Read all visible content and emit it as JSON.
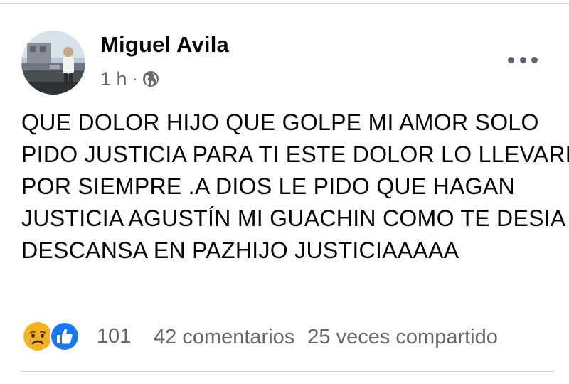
{
  "post": {
    "author": "Miguel Avila",
    "time": "1 h",
    "separator": "·",
    "privacy_icon": "globe-icon",
    "more_icon": "more-horizontal-icon",
    "text_lines": [
      "QUE DOLOR HIJO QUE GOLPE MI AMOR SOLO",
      "PIDO JUSTICIA PARA TI ESTE DOLOR LO LLEVARÉ",
      "POR SIEMPRE .A DIOS LE PIDO QUE HAGAN",
      "JUSTICIA AGUSTÍN MI GUACHIN COMO TE DESIA",
      "DESCANSA EN PAZHIJO JUSTICIAAAAA"
    ]
  },
  "footer": {
    "reaction_icons": [
      "sad-reaction-icon",
      "like-reaction-icon"
    ],
    "reaction_count": "101",
    "comments": "42 comentarios",
    "shares": "25 veces compartido"
  },
  "colors": {
    "text_primary": "#050505",
    "text_secondary": "#65676b",
    "like_blue": "#1877f2",
    "sad_yellow": "#f7b928",
    "divider": "#ced0d4"
  }
}
